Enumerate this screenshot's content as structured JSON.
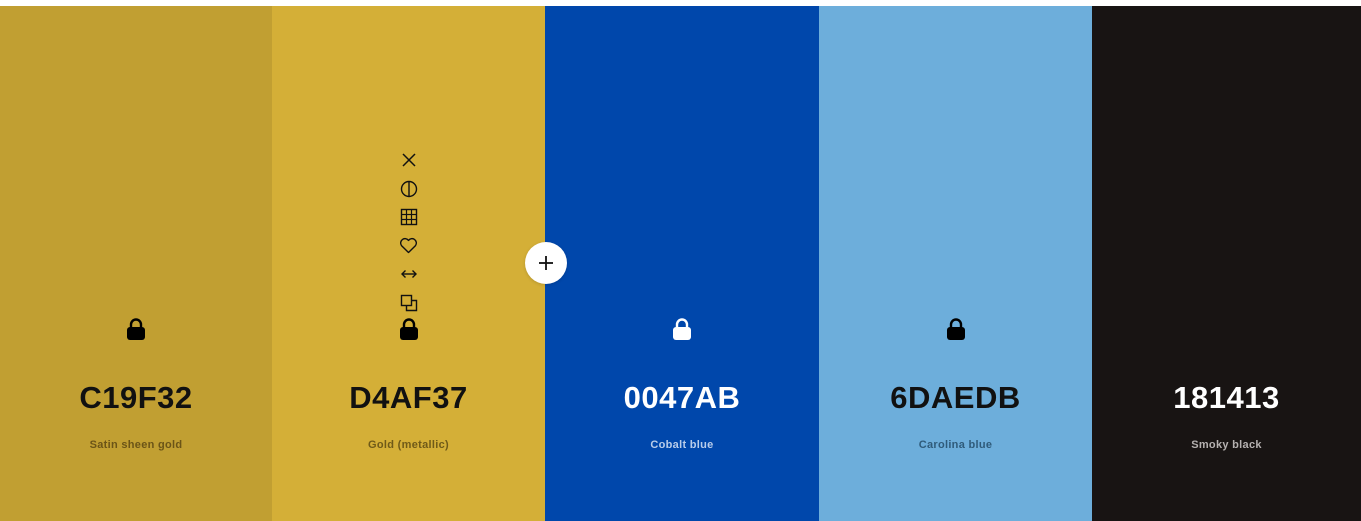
{
  "colors": [
    {
      "hex": "C19F32",
      "name": "Satin sheen gold",
      "background": "#C19F32",
      "text_color": "#111111",
      "name_color": "#6b5417",
      "lock_color": "#000000",
      "lock_icon": "lock-icon"
    },
    {
      "hex": "D4AF37",
      "name": "Gold (metallic)",
      "background": "#D4AF37",
      "text_color": "#111111",
      "name_color": "#6f5a18",
      "lock_color": "#000000",
      "lock_icon": "lock-icon",
      "tools": [
        "close-icon",
        "contrast-icon",
        "grid-icon",
        "heart-icon",
        "arrows-horizontal-icon",
        "copy-icon"
      ]
    },
    {
      "hex": "0047AB",
      "name": "Cobalt blue",
      "background": "#0047AB",
      "text_color": "#ffffff",
      "name_color": "#b9cdea",
      "lock_color": "#ffffff",
      "lock_icon": "lock-icon"
    },
    {
      "hex": "6DAEDB",
      "name": "Carolina blue",
      "background": "#6DAEDB",
      "text_color": "#111111",
      "name_color": "#2f5b7a",
      "lock_color": "#000000",
      "lock_icon": "lock-icon"
    },
    {
      "hex": "181413",
      "name": "Smoky black",
      "background": "#181413",
      "text_color": "#ffffff",
      "name_color": "#b5b1b0"
    }
  ],
  "add_button": {
    "icon": "plus-icon"
  }
}
